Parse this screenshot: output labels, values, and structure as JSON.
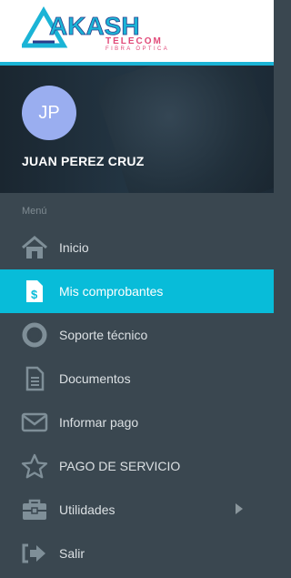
{
  "brand": {
    "logo_text": "AKASH",
    "subtitle_1": "TELECOM",
    "subtitle_2": "FIBRA ÓPTICA",
    "colors": {
      "logo_blue": "#1bb4d6",
      "logo_magenta": "#e14a79"
    }
  },
  "profile": {
    "avatar_initials": "JP",
    "name": "JUAN PEREZ CRUZ"
  },
  "menu": {
    "header": "Menú",
    "items": [
      {
        "label": "Inicio",
        "icon": "home-icon",
        "active": false
      },
      {
        "label": "Mis comprobantes",
        "icon": "receipt-icon",
        "active": true
      },
      {
        "label": "Soporte técnico",
        "icon": "lifebuoy-icon",
        "active": false
      },
      {
        "label": "Documentos",
        "icon": "document-icon",
        "active": false
      },
      {
        "label": "Informar pago",
        "icon": "envelope-icon",
        "active": false
      },
      {
        "label": "PAGO DE SERVICIO",
        "icon": "star-icon",
        "active": false
      },
      {
        "label": "Utilidades",
        "icon": "toolbox-icon",
        "active": false,
        "has_submenu": true
      },
      {
        "label": "Salir",
        "icon": "logout-icon",
        "active": false
      }
    ]
  },
  "theme": {
    "sidebar_bg": "#3a4750",
    "active_bg": "#08bcd9",
    "text": "#dbe0e3"
  }
}
